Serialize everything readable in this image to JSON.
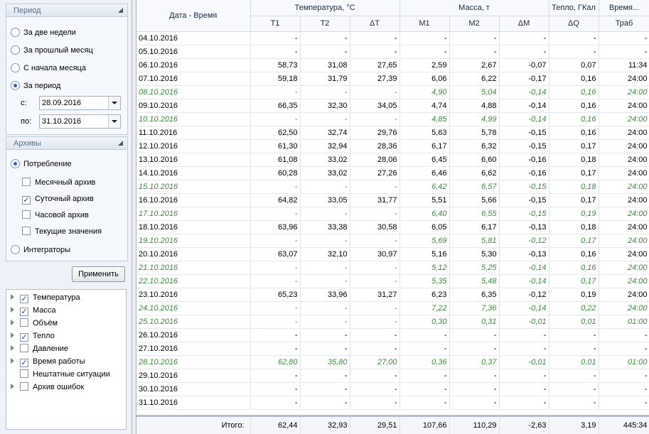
{
  "period": {
    "header": "Период",
    "options": [
      "За две недели",
      "За прошлый месяц",
      "С начала месяца",
      "За период"
    ],
    "selected": 3,
    "from_label": "с:",
    "from_value": "28.09.2016",
    "to_label": "по:",
    "to_value": "31.10.2016"
  },
  "archives": {
    "header": "Архивы",
    "consumption_label": "Потребление",
    "consumption_selected": true,
    "checks": [
      {
        "label": "Месячный архив",
        "checked": false
      },
      {
        "label": "Суточный архив",
        "checked": true
      },
      {
        "label": "Часовой архив",
        "checked": false
      },
      {
        "label": "Текущие значения",
        "checked": false
      }
    ],
    "integrators_label": "Интеграторы",
    "integrators_selected": false
  },
  "apply_label": "Применить",
  "tree": [
    {
      "label": "Температура",
      "checked": true,
      "expandable": true
    },
    {
      "label": "Масса",
      "checked": true,
      "expandable": true
    },
    {
      "label": "Объём",
      "checked": false,
      "expandable": true
    },
    {
      "label": "Тепло",
      "checked": true,
      "expandable": true
    },
    {
      "label": "Давление",
      "checked": false,
      "expandable": true
    },
    {
      "label": "Время работы",
      "checked": true,
      "expandable": true
    },
    {
      "label": "Нештатные ситуации",
      "checked": false,
      "expandable": false
    },
    {
      "label": "Архив ошибок",
      "checked": false,
      "expandable": true
    }
  ],
  "grid": {
    "date_header": "Дата - Время",
    "groups": [
      {
        "label": "Температура, °С",
        "span": 3
      },
      {
        "label": "Масса, т",
        "span": 3
      },
      {
        "label": "Тепло, ГКал",
        "span": 1
      },
      {
        "label": "Время...",
        "span": 1
      }
    ],
    "columns": [
      "T1",
      "T2",
      "ΔT",
      "M1",
      "M2",
      "ΔM",
      "ΔQ",
      "Траб"
    ],
    "rows": [
      {
        "date": "04.10.2016",
        "v": [
          "-",
          "-",
          "-",
          "-",
          "-",
          "-",
          "-",
          "-"
        ],
        "ital": false
      },
      {
        "date": "05.10.2016",
        "v": [
          "-",
          "-",
          "-",
          "-",
          "-",
          "-",
          "-",
          "-"
        ],
        "ital": false
      },
      {
        "date": "06.10.2016",
        "v": [
          "58,73",
          "31,08",
          "27,65",
          "2,59",
          "2,67",
          "-0,07",
          "0,07",
          "11:34"
        ],
        "ital": false
      },
      {
        "date": "07.10.2016",
        "v": [
          "59,18",
          "31,79",
          "27,39",
          "6,06",
          "6,22",
          "-0,17",
          "0,16",
          "24:00"
        ],
        "ital": false
      },
      {
        "date": "08.10.2016",
        "v": [
          "-",
          "-",
          "-",
          "4,90",
          "5,04",
          "-0,14",
          "0,16",
          "24:00"
        ],
        "ital": true
      },
      {
        "date": "09.10.2016",
        "v": [
          "66,35",
          "32,30",
          "34,05",
          "4,74",
          "4,88",
          "-0,14",
          "0,16",
          "24:00"
        ],
        "ital": false
      },
      {
        "date": "10.10.2016",
        "v": [
          "-",
          "-",
          "-",
          "4,85",
          "4,99",
          "-0,14",
          "0,16",
          "24:00"
        ],
        "ital": true
      },
      {
        "date": "11.10.2016",
        "v": [
          "62,50",
          "32,74",
          "29,76",
          "5,63",
          "5,78",
          "-0,15",
          "0,16",
          "24:00"
        ],
        "ital": false
      },
      {
        "date": "12.10.2016",
        "v": [
          "61,30",
          "32,94",
          "28,36",
          "6,17",
          "6,32",
          "-0,15",
          "0,17",
          "24:00"
        ],
        "ital": false
      },
      {
        "date": "13.10.2016",
        "v": [
          "61,08",
          "33,02",
          "28,06",
          "6,45",
          "6,60",
          "-0,16",
          "0,18",
          "24:00"
        ],
        "ital": false
      },
      {
        "date": "14.10.2016",
        "v": [
          "60,28",
          "33,02",
          "27,26",
          "6,46",
          "6,62",
          "-0,16",
          "0,17",
          "24:00"
        ],
        "ital": false
      },
      {
        "date": "15.10.2016",
        "v": [
          "-",
          "-",
          "-",
          "6,42",
          "6,57",
          "-0,15",
          "0,18",
          "24:00"
        ],
        "ital": true
      },
      {
        "date": "16.10.2016",
        "v": [
          "64,82",
          "33,05",
          "31,77",
          "5,51",
          "5,66",
          "-0,15",
          "0,17",
          "24:00"
        ],
        "ital": false
      },
      {
        "date": "17.10.2016",
        "v": [
          "-",
          "-",
          "-",
          "6,40",
          "6,55",
          "-0,15",
          "0,19",
          "24:00"
        ],
        "ital": true
      },
      {
        "date": "18.10.2016",
        "v": [
          "63,96",
          "33,38",
          "30,58",
          "6,05",
          "6,17",
          "-0,13",
          "0,18",
          "24:00"
        ],
        "ital": false
      },
      {
        "date": "19.10.2016",
        "v": [
          "-",
          "-",
          "-",
          "5,69",
          "5,81",
          "-0,12",
          "0,17",
          "24:00"
        ],
        "ital": true
      },
      {
        "date": "20.10.2016",
        "v": [
          "63,07",
          "32,10",
          "30,97",
          "5,16",
          "5,30",
          "-0,13",
          "0,16",
          "24:00"
        ],
        "ital": false
      },
      {
        "date": "21.10.2016",
        "v": [
          "-",
          "-",
          "-",
          "5,12",
          "5,25",
          "-0,14",
          "0,16",
          "24:00"
        ],
        "ital": true
      },
      {
        "date": "22.10.2016",
        "v": [
          "-",
          "-",
          "-",
          "5,35",
          "5,48",
          "-0,14",
          "0,17",
          "24:00"
        ],
        "ital": true
      },
      {
        "date": "23.10.2016",
        "v": [
          "65,23",
          "33,96",
          "31,27",
          "6,23",
          "6,35",
          "-0,12",
          "0,19",
          "24:00"
        ],
        "ital": false
      },
      {
        "date": "24.10.2016",
        "v": [
          "-",
          "-",
          "-",
          "7,22",
          "7,36",
          "-0,14",
          "0,22",
          "24:00"
        ],
        "ital": true
      },
      {
        "date": "25.10.2016",
        "v": [
          "-",
          "-",
          "-",
          "0,30",
          "0,31",
          "-0,01",
          "0,01",
          "01:00"
        ],
        "ital": true,
        "mark": true
      },
      {
        "date": "26.10.2016",
        "v": [
          "-",
          "-",
          "-",
          "-",
          "-",
          "-",
          "-",
          "-"
        ],
        "ital": false
      },
      {
        "date": "27.10.2016",
        "v": [
          "-",
          "-",
          "-",
          "-",
          "-",
          "-",
          "-",
          "-"
        ],
        "ital": false
      },
      {
        "date": "28.10.2016",
        "v": [
          "62,80",
          "35,80",
          "27,00",
          "0,36",
          "0,37",
          "-0,01",
          "0,01",
          "01:00"
        ],
        "ital": true,
        "mark": true
      },
      {
        "date": "29.10.2016",
        "v": [
          "-",
          "-",
          "-",
          "-",
          "-",
          "-",
          "-",
          "-"
        ],
        "ital": false
      },
      {
        "date": "30.10.2016",
        "v": [
          "-",
          "-",
          "-",
          "-",
          "-",
          "-",
          "-",
          "-"
        ],
        "ital": false
      },
      {
        "date": "31.10.2016",
        "v": [
          "-",
          "-",
          "-",
          "-",
          "-",
          "-",
          "-",
          "-"
        ],
        "ital": false
      }
    ],
    "totals_label": "Итого:",
    "totals": [
      "62,44",
      "32,93",
      "29,51",
      "107,66",
      "110,29",
      "-2,63",
      "3,19",
      "445:34"
    ]
  },
  "colors": {
    "accent": "#2b66c7",
    "italic_row": "#3c8a3c",
    "marker": "#4a86c7"
  }
}
